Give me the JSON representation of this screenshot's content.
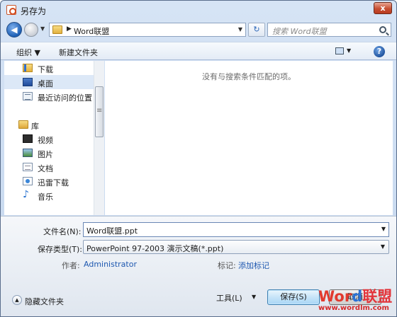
{
  "window": {
    "title": "另存为",
    "close_label": "x"
  },
  "nav": {
    "back": "◀",
    "forward": "▶",
    "history": "▼",
    "refresh": "↻"
  },
  "address": {
    "chevron": "▶",
    "path": "Word联盟",
    "dropdown": "▼"
  },
  "search": {
    "placeholder": "搜索 Word联盟"
  },
  "toolbar": {
    "organize_label": "组织 ▼",
    "new_folder_label": "新建文件夹",
    "views_dropdown": "▼",
    "help": "?"
  },
  "sidebar": {
    "items": [
      {
        "label": "下载",
        "icon": "downloads-icon"
      },
      {
        "label": "桌面",
        "icon": "desktop-icon",
        "selected": true
      },
      {
        "label": "最近访问的位置",
        "icon": "recent-places-icon"
      },
      {
        "label": "库",
        "icon": "libraries-icon"
      },
      {
        "label": "视频",
        "icon": "videos-icon"
      },
      {
        "label": "图片",
        "icon": "pictures-icon"
      },
      {
        "label": "文档",
        "icon": "documents-icon"
      },
      {
        "label": "迅雷下载",
        "icon": "xunlei-download-icon"
      },
      {
        "label": "音乐",
        "icon": "music-icon"
      }
    ]
  },
  "filelist": {
    "empty_message": "没有与搜索条件匹配的项。"
  },
  "form": {
    "filename_label": "文件名(N):",
    "filename_value": "Word联盟.ppt",
    "filetype_label": "保存类型(T):",
    "filetype_value": "PowerPoint 97-2003 演示文稿(*.ppt)",
    "author_label": "作者:",
    "author_value": "Administrator",
    "tags_label": "标记:",
    "tags_value": "添加标记",
    "dropdown": "▼"
  },
  "footer": {
    "hide_folders_label": "隐藏文件夹",
    "hide_arrow": "▲",
    "tools_label": "工具(L)",
    "save_label": "保存(S)",
    "cancel_label": "取消"
  },
  "watermark": {
    "logo_part1": "Wor",
    "logo_part2": "d",
    "logo_part3": "联盟",
    "url": "www.wordlm.com"
  },
  "colors": {
    "link": "#1e58b0",
    "selection": "#dce8f7",
    "close": "#c74f32"
  }
}
